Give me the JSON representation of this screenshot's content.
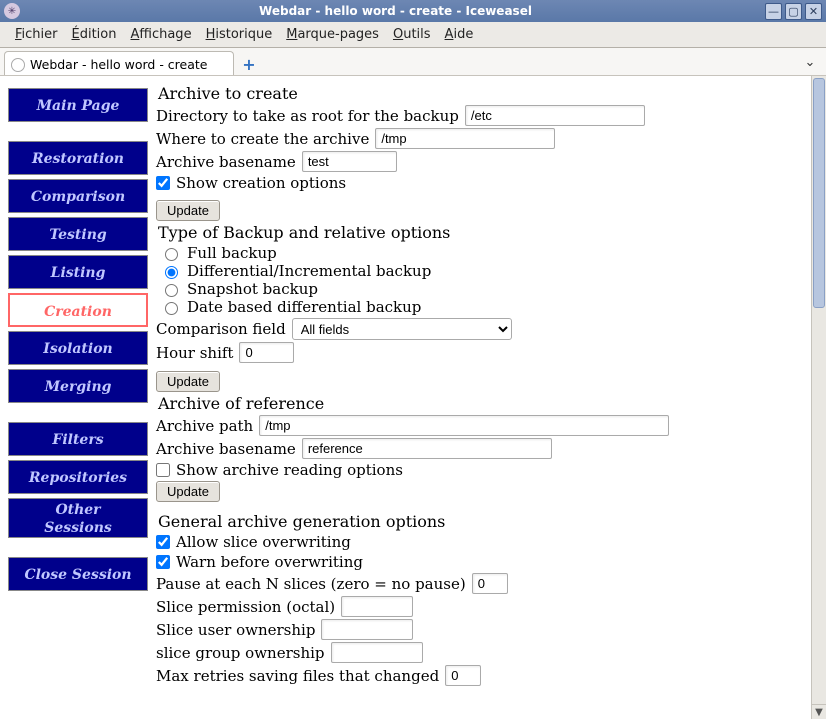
{
  "window": {
    "title": "Webdar - hello word - create - Iceweasel"
  },
  "menubar": [
    {
      "ul": "F",
      "rest": "ichier"
    },
    {
      "ul": "É",
      "rest": "dition"
    },
    {
      "ul": "A",
      "rest": "ffichage"
    },
    {
      "ul": "H",
      "rest": "istorique"
    },
    {
      "ul": "M",
      "rest": "arque-pages"
    },
    {
      "ul": "O",
      "rest": "utils"
    },
    {
      "ul": "A",
      "rest": "ide"
    }
  ],
  "tab": {
    "label": "Webdar - hello word - create"
  },
  "sidebar": {
    "g1": [
      "Main Page"
    ],
    "g2": [
      "Restoration",
      "Comparison",
      "Testing",
      "Listing",
      "Creation",
      "Isolation",
      "Merging"
    ],
    "g3": [
      "Filters",
      "Repositories",
      "Other Sessions"
    ],
    "g4": [
      "Close Session"
    ],
    "active": "Creation"
  },
  "form": {
    "archive_to_create": "Archive to create",
    "dir_root_label": "Directory to take as root for the backup",
    "dir_root_value": "/etc",
    "where_label": "Where to create the archive",
    "where_value": "/tmp",
    "basename_label": "Archive basename",
    "basename_value": "test",
    "show_creation_label": "Show creation options",
    "show_creation_checked": true,
    "update_label": "Update",
    "type_section": "Type of Backup and relative options",
    "radios": [
      {
        "label": "Full backup",
        "checked": false
      },
      {
        "label": "Differential/Incremental backup",
        "checked": true
      },
      {
        "label": "Snapshot backup",
        "checked": false
      },
      {
        "label": "Date based differential backup",
        "checked": false
      }
    ],
    "cmp_field_label": "Comparison field",
    "cmp_field_value": "All fields",
    "hour_shift_label": "Hour shift",
    "hour_shift_value": "0",
    "ref_section": "Archive of reference",
    "ref_path_label": "Archive path",
    "ref_path_value": "/tmp",
    "ref_basename_label": "Archive basename",
    "ref_basename_value": "reference",
    "show_reading_label": "Show archive reading options",
    "show_reading_checked": false,
    "gen_section": "General archive generation options",
    "allow_slice_label": "Allow slice overwriting",
    "allow_slice_checked": true,
    "warn_ow_label": "Warn before overwriting",
    "warn_ow_checked": true,
    "pause_label": "Pause at each N slices (zero = no pause)",
    "pause_value": "0",
    "slice_perm_label": "Slice permission (octal)",
    "slice_perm_value": "",
    "slice_user_label": "Slice user ownership",
    "slice_user_value": "",
    "slice_group_label": "slice group ownership",
    "slice_group_value": "",
    "max_retries_label": "Max retries saving files that changed",
    "max_retries_value": "0"
  }
}
